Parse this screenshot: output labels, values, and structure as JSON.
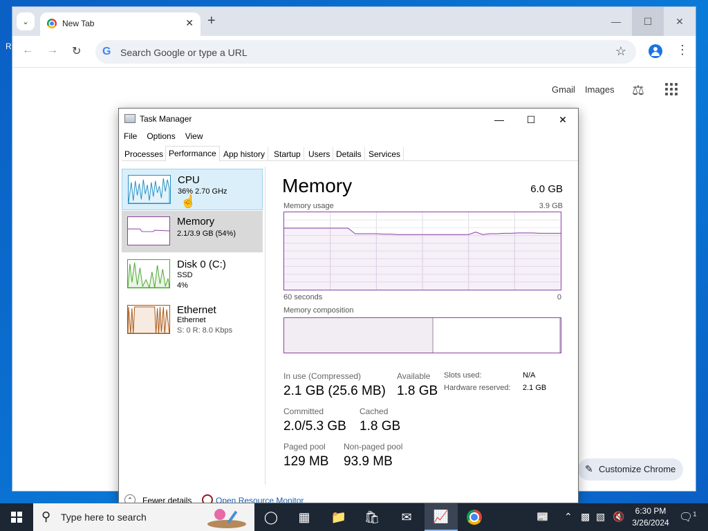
{
  "desktop": {
    "fragment": "R"
  },
  "browser": {
    "tab_title": "New Tab",
    "omnibox_placeholder": "Search Google or type a URL",
    "links": {
      "gmail": "Gmail",
      "images": "Images"
    },
    "customize_label": "Customize Chrome",
    "icons": [
      "tab-list-icon",
      "chrome-favicon",
      "close-icon",
      "plus-icon",
      "minimize-icon",
      "maximize-icon",
      "close-icon",
      "back-icon",
      "forward-icon",
      "reload-icon",
      "google-icon",
      "star-icon",
      "profile-icon",
      "more-icon",
      "labs-icon",
      "apps-icon",
      "pencil-icon"
    ]
  },
  "task_manager": {
    "title": "Task Manager",
    "menu": [
      "File",
      "Options",
      "View"
    ],
    "tabs": [
      "Processes",
      "Performance",
      "App history",
      "Startup",
      "Users",
      "Details",
      "Services"
    ],
    "active_tab": "Performance",
    "sidebar": [
      {
        "name": "CPU",
        "line1": "36%  2.70 GHz",
        "line2": "",
        "color": "#1f8fc4"
      },
      {
        "name": "Memory",
        "line1": "2.1/3.9 GB (54%)",
        "line2": "",
        "color": "#8b3fa3"
      },
      {
        "name": "Disk 0 (C:)",
        "line1": "SSD",
        "line2": "4%",
        "color": "#4aa52e"
      },
      {
        "name": "Ethernet",
        "line1": "Ethernet",
        "line2": "S: 0 R: 8.0 Kbps",
        "color": "#a7520d"
      }
    ],
    "memory": {
      "title": "Memory",
      "total": "6.0 GB",
      "usage_label": "Memory usage",
      "usage_max": "3.9 GB",
      "axis_left": "60 seconds",
      "axis_right": "0",
      "usage_points": [
        3.1,
        3.1,
        3.1,
        3.1,
        3.1,
        3.1,
        3.1,
        3.1,
        3.1,
        3.1,
        2.82,
        2.82,
        2.82,
        2.82,
        2.8,
        2.8,
        2.78,
        2.78,
        2.78,
        2.78,
        2.78,
        2.78,
        2.78,
        2.78,
        2.78,
        2.78,
        2.78,
        2.9,
        2.78,
        2.82,
        2.82,
        2.84,
        2.84,
        2.86,
        2.86,
        2.86,
        2.84,
        2.84,
        2.84,
        2.84
      ],
      "composition_label": "Memory composition",
      "composition_in_use_fraction": 0.54,
      "in_use_label": "In use (Compressed)",
      "in_use_value": "2.1 GB (25.6 MB)",
      "available_label": "Available",
      "available_value": "1.8 GB",
      "committed_label": "Committed",
      "committed_value": "2.0/5.3 GB",
      "cached_label": "Cached",
      "cached_value": "1.8 GB",
      "paged_label": "Paged pool",
      "paged_value": "129 MB",
      "nonpaged_label": "Non-paged pool",
      "nonpaged_value": "93.9 MB",
      "slots_label": "Slots used:",
      "slots_value": "N/A",
      "hw_reserved_label": "Hardware reserved:",
      "hw_reserved_value": "2.1 GB"
    },
    "footer": {
      "fewer": "Fewer details",
      "resource_monitor": "Open Resource Monitor"
    }
  },
  "taskbar": {
    "search_placeholder": "Type here to search",
    "time": "6:30 PM",
    "date": "3/26/2024",
    "notification_count": "1"
  }
}
